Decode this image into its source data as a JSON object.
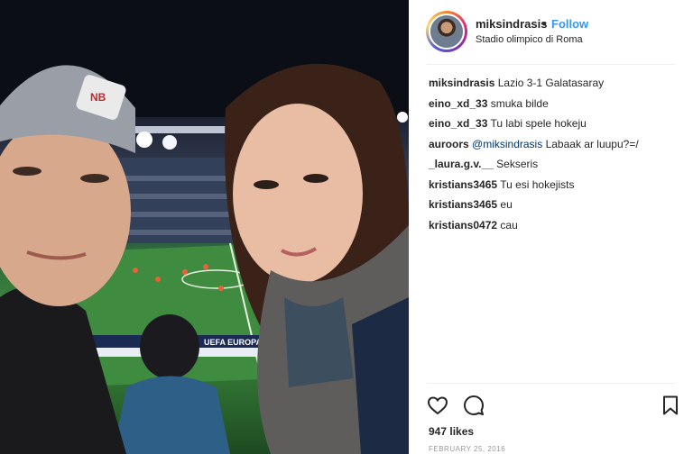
{
  "post": {
    "username": "miksindrasis",
    "separator": "•",
    "follow_label": "Follow",
    "location": "Stadio olimpico di Roma",
    "likes": "947 likes",
    "date": "FEBRUARY 25, 2016"
  },
  "photo": {
    "banner_text": "UEFA EUROPA L",
    "beanie_brand": "NB"
  },
  "comments": [
    {
      "user": "miksindrasis",
      "mention": "",
      "text": "Lazio 3-1 Galatasaray"
    },
    {
      "user": "eino_xd_33",
      "mention": "",
      "text": "smuka bilde"
    },
    {
      "user": "eino_xd_33",
      "mention": "",
      "text": "Tu labi spele hokeju"
    },
    {
      "user": "auroors",
      "mention": "@miksindrasis",
      "text": "Labaak ar luupu?=/"
    },
    {
      "user": "_laura.g.v.__",
      "mention": "",
      "text": "Sekseris"
    },
    {
      "user": "kristians3465",
      "mention": "",
      "text": "Tu esi hokejists"
    },
    {
      "user": "kristians3465",
      "mention": "",
      "text": "eu"
    },
    {
      "user": "kristians0472",
      "mention": "",
      "text": "cau"
    }
  ],
  "icons": {
    "like": "heart-icon",
    "comment": "comment-icon",
    "save": "bookmark-icon"
  },
  "colors": {
    "follow": "#3897f0",
    "mention": "#003569",
    "text": "#262626",
    "muted": "#999999"
  }
}
